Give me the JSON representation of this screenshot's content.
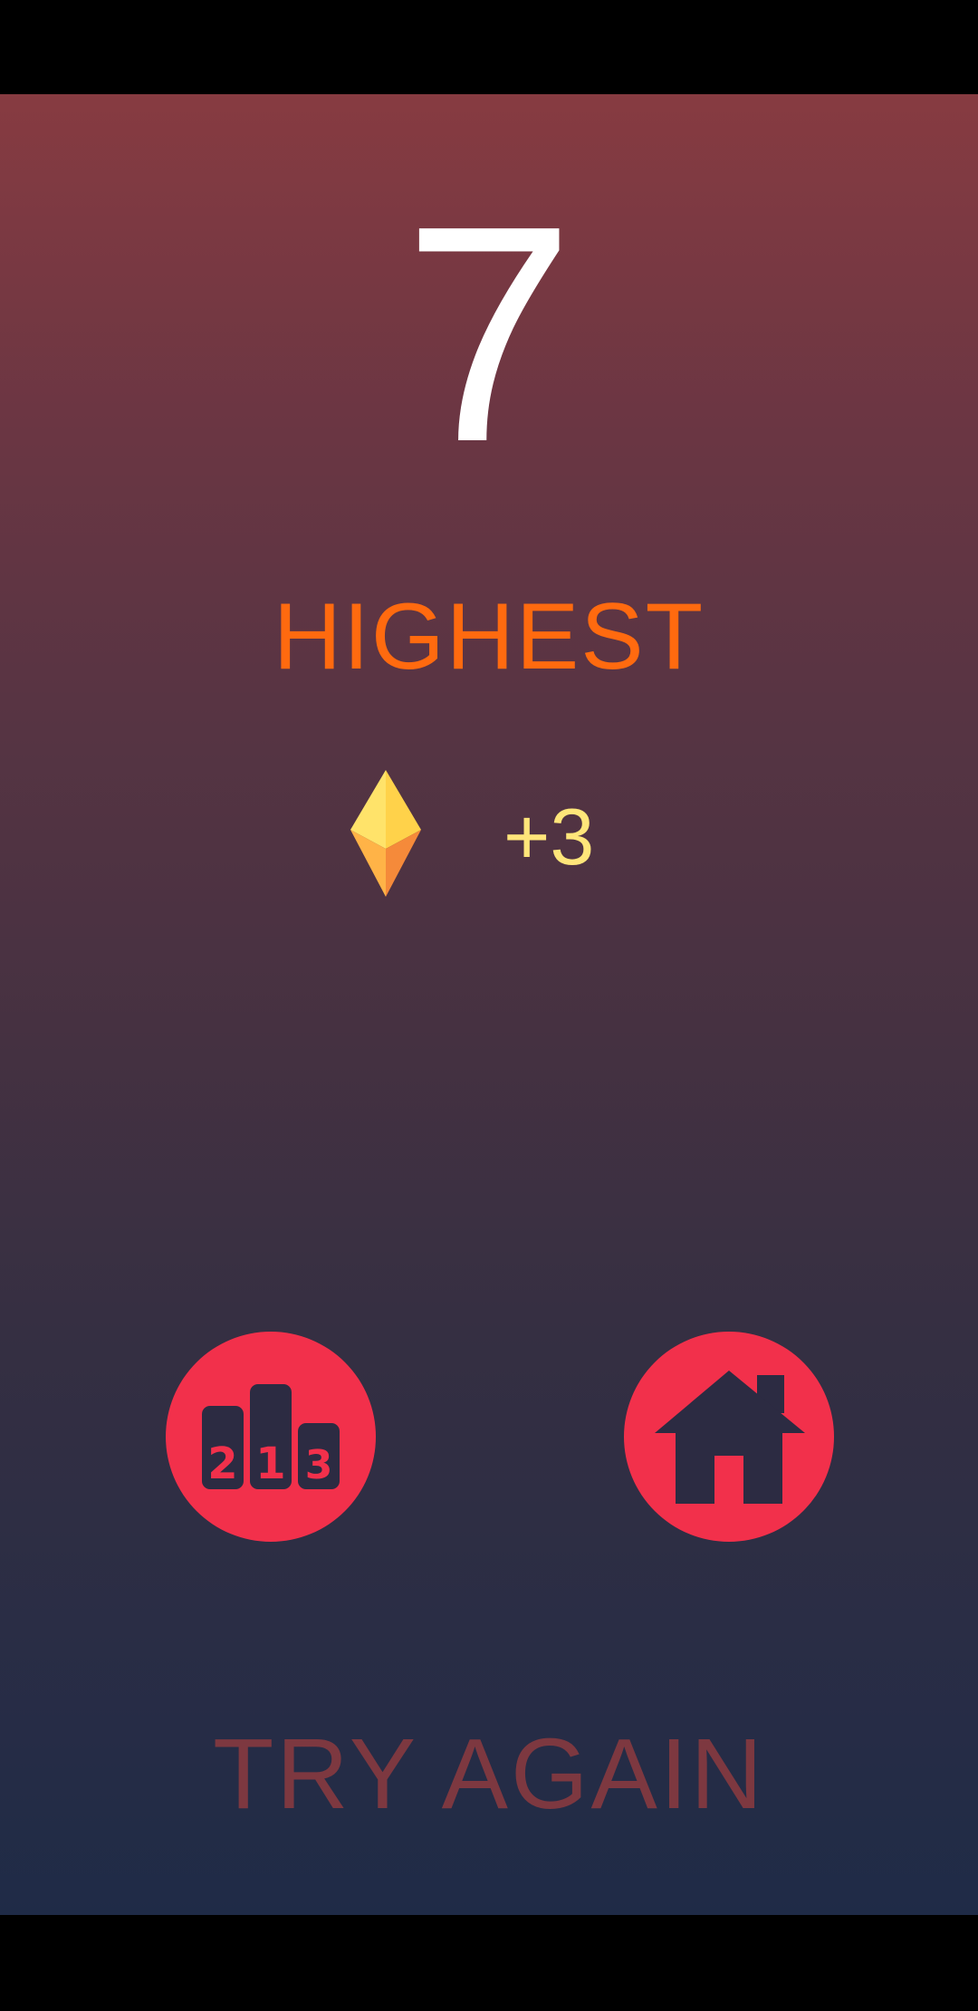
{
  "game": {
    "score": "7",
    "status_label": "HIGHEST",
    "gem_reward": "+3"
  },
  "buttons": {
    "leaderboard_icon": "leaderboard-podium-icon",
    "leaderboard_ranks": [
      "2",
      "1",
      "3"
    ],
    "home_icon": "home-icon",
    "try_again_label": "TRY AGAIN"
  },
  "colors": {
    "score": "#ffffff",
    "highest": "#ff6a0f",
    "gem_reward": "#ffe67a",
    "button_fill": "#f2304b",
    "icon_fill": "#2c2b42",
    "try_again": "#7d3840",
    "gradient_top": "#873b41",
    "gradient_bottom": "#1f2b47"
  }
}
